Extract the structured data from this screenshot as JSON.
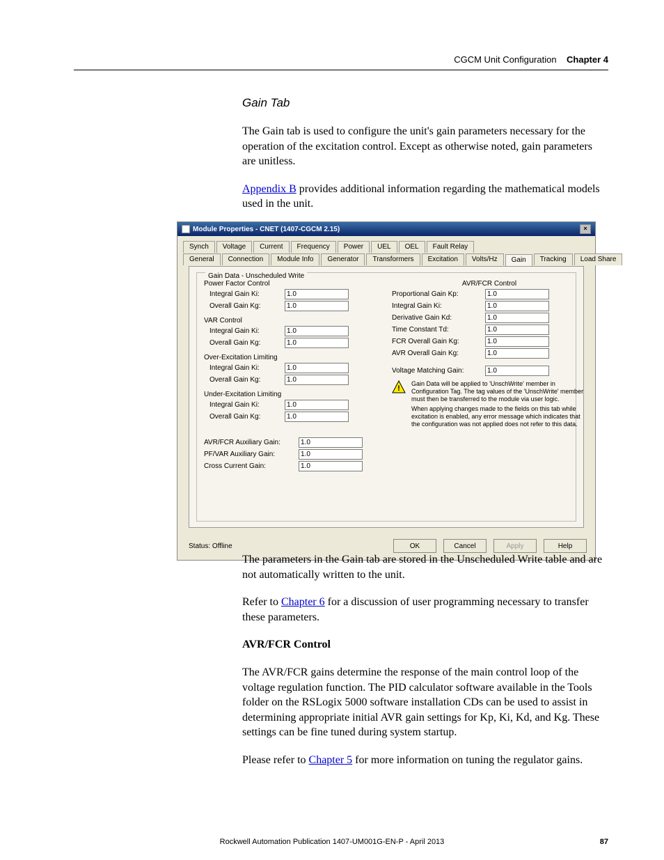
{
  "header": {
    "text": "CGCM Unit Configuration",
    "chapter": "Chapter 4"
  },
  "section_title": "Gain Tab",
  "para1": "The Gain tab is used to configure the unit's gain parameters necessary for the operation of the excitation control. Except as otherwise noted, gain parameters are unitless.",
  "para2_a": "Appendix B",
  "para2_b": " provides additional information regarding the mathematical models used in the unit.",
  "dialog": {
    "title": "Module Properties  - CNET (1407-CGCM 2.15)",
    "tabs_row1": [
      "Synch",
      "Voltage",
      "Current",
      "Frequency",
      "Power",
      "UEL",
      "OEL",
      "Fault Relay"
    ],
    "tabs_row2": [
      "General",
      "Connection",
      "Module Info",
      "Generator",
      "Transformers",
      "Excitation",
      "Volts/Hz",
      "Gain",
      "Tracking",
      "Load Share"
    ],
    "active_tab": "Gain",
    "group": "Gain Data - Unscheduled Write",
    "left": {
      "pf_title": "Power Factor Control",
      "pf_ki_label": "Integral Gain Ki:",
      "pf_ki": "1.0",
      "pf_kg_label": "Overall Gain Kg:",
      "pf_kg": "1.0",
      "var_title": "VAR Control",
      "var_ki_label": "Integral Gain Ki:",
      "var_ki": "1.0",
      "var_kg_label": "Overall Gain Kg:",
      "var_kg": "1.0",
      "oel_title": "Over-Excitation Limiting",
      "oel_ki_label": "Integral Gain Ki:",
      "oel_ki": "1.0",
      "oel_kg_label": "Overall Gain Kg:",
      "oel_kg": "1.0",
      "uel_title": "Under-Excitation Limiting",
      "uel_ki_label": "Integral Gain Ki:",
      "uel_ki": "1.0",
      "uel_kg_label": "Overall Gain Kg:",
      "uel_kg": "1.0",
      "aux1_label": "AVR/FCR Auxiliary Gain:",
      "aux1": "1.0",
      "aux2_label": "PF/VAR Auxiliary Gain:",
      "aux2": "1.0",
      "cc_label": "Cross Current Gain:",
      "cc": "1.0"
    },
    "right": {
      "title": "AVR/FCR Control",
      "kp_label": "Proportional Gain Kp:",
      "kp": "1.0",
      "ki_label": "Integral Gain Ki:",
      "ki": "1.0",
      "kd_label": "Derivative Gain Kd:",
      "kd": "1.0",
      "td_label": "Time Constant Td:",
      "td": "1.0",
      "fcr_kg_label": "FCR Overall Gain Kg:",
      "fcr_kg": "1.0",
      "avr_kg_label": "AVR Overall Gain Kg:",
      "avr_kg": "1.0",
      "vm_label": "Voltage Matching Gain:",
      "vm": "1.0",
      "warn1": "Gain Data will be applied to 'UnschWrite' member in Configuration Tag. The tag values of the 'UnschWrite' member must then be transferred to the module via user logic.",
      "warn2": "When applying changes made to the fields on this tab while excitation is enabled, any error message which indicates that the configuration was not applied does not refer to this data."
    },
    "status": "Status:  Offline",
    "buttons": {
      "ok": "OK",
      "cancel": "Cancel",
      "apply": "Apply",
      "help": "Help"
    }
  },
  "para3": "The parameters in the Gain tab are stored in the Unscheduled Write table and are not automatically written to the unit.",
  "para4_a": "Refer to ",
  "para4_link": "Chapter 6",
  "para4_b": " for a discussion of user programming necessary to transfer these parameters.",
  "h2": "AVR/FCR Control",
  "para5": "The AVR/FCR gains determine the response of the main control loop of the voltage regulation function. The PID calculator software available in the Tools folder on the RSLogix 5000 software installation CDs can be used to assist in determining appropriate initial AVR gain settings for Kp, Ki, Kd, and Kg. These settings can be fine tuned during system startup.",
  "para6_a": "Please refer to ",
  "para6_link": "Chapter 5",
  "para6_b": " for more information on tuning the regulator gains.",
  "footer": {
    "pub": "Rockwell Automation Publication 1407-UM001G-EN-P - April 2013",
    "page": "87"
  }
}
